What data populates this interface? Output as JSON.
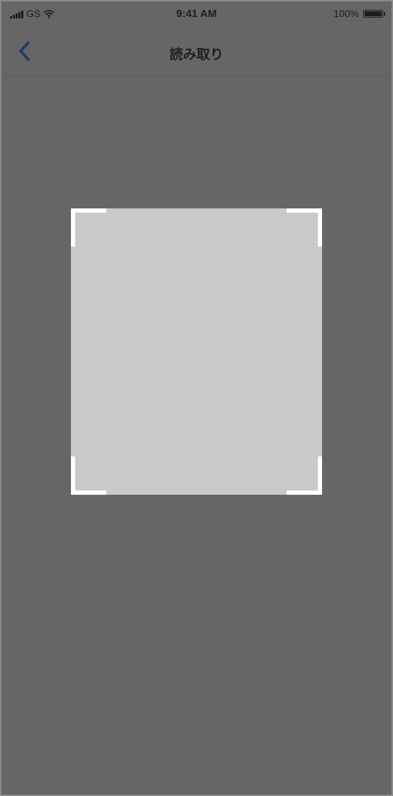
{
  "status_bar": {
    "carrier": "GS",
    "time": "9:41 AM",
    "battery_percent": "100%",
    "icons": [
      "signal-icon",
      "wifi-icon",
      "battery-icon"
    ]
  },
  "nav": {
    "title": "読み取り",
    "back_icon": "chevron-left-icon"
  },
  "scanner": {
    "corner_icon": "scan-corner"
  },
  "colors": {
    "background": "#666666",
    "scan_area": "#c9c9c9",
    "corner": "#ffffff",
    "back_icon": "#1f3a66",
    "text": "#1e1e1e"
  }
}
